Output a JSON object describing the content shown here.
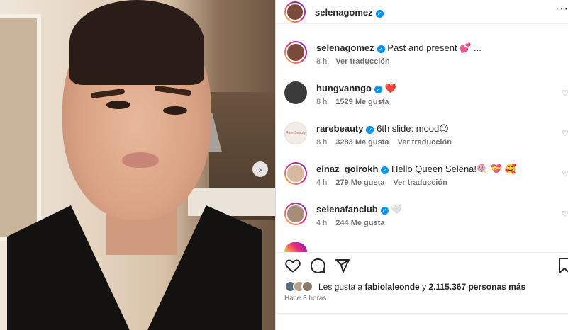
{
  "post": {
    "author": "selenagomez",
    "time_ago": "Hace 8 horas"
  },
  "comments": [
    {
      "user": "selenagomez",
      "verified": true,
      "body": "Past and present 💕 ...",
      "time": "8 h",
      "likes": "",
      "translate": "Ver traducción",
      "avatar_color": "#7a4a3a"
    },
    {
      "user": "hungvanngo",
      "verified": true,
      "body": "❤️",
      "time": "8 h",
      "likes": "1529 Me gusta",
      "translate": "",
      "avatar_color": "#3b3b3b"
    },
    {
      "user": "rarebeauty",
      "verified": true,
      "body": "6th slide: mood😉",
      "time": "8 h",
      "likes": "3283 Me gusta",
      "translate": "Ver traducción",
      "avatar_color": "#f3ece6",
      "avatar_text": "Rare Beauty"
    },
    {
      "user": "elnaz_golrokh",
      "verified": true,
      "body": "Hello Queen Selena!🍭 💝 🥰",
      "time": "4 h",
      "likes": "279 Me gusta",
      "translate": "Ver traducción",
      "avatar_color": "#d9b8a0"
    },
    {
      "user": "selenafanclub",
      "verified": true,
      "body": "🤍",
      "time": "4 h",
      "likes": "244 Me gusta",
      "translate": "",
      "avatar_color": "#a88c7a"
    }
  ],
  "likes": {
    "prefix": "Les gusta a ",
    "user": "fabiolaleonde",
    "middle": " y ",
    "count": "2.115.367 personas más"
  },
  "icons": {
    "like": "heart-outline-icon",
    "comment": "comment-bubble-icon",
    "share": "paper-plane-icon",
    "save": "bookmark-icon",
    "more": "more-dots-icon",
    "next": "chevron-right-icon"
  },
  "colors": {
    "verified": "#0095f6",
    "like_heart": "#ed4956",
    "text": "#262626",
    "muted": "#737373"
  }
}
